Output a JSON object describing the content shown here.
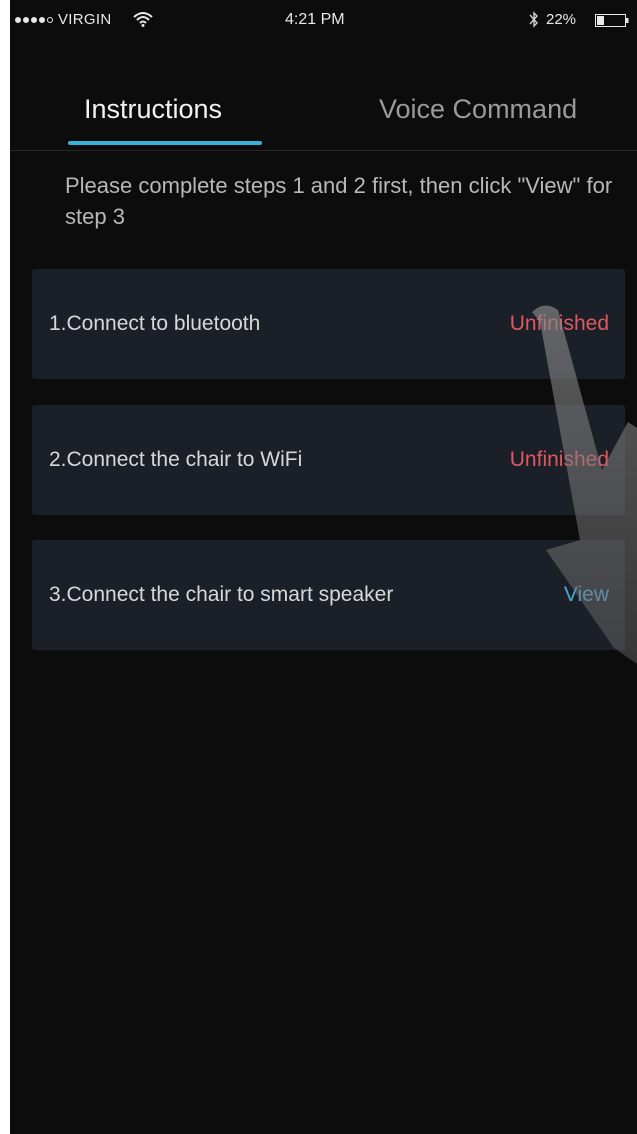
{
  "status_bar": {
    "carrier": "VIRGIN",
    "time": "4:21 PM",
    "battery": "22%"
  },
  "tabs": [
    {
      "label": "Instructions",
      "active": true
    },
    {
      "label": "Voice Command",
      "active": false
    }
  ],
  "info": "Please complete steps 1 and 2 first, then click \"View\" for step 3",
  "steps": [
    {
      "label": "1.Connect to bluetooth",
      "status": "Unfinished"
    },
    {
      "label": "2.Connect the chair to WiFi",
      "status": "Unfinished"
    },
    {
      "label": "3.Connect the chair to smart speaker",
      "status": "View"
    }
  ],
  "colors": {
    "background": "#0c0c0c",
    "card": "#1b1f27",
    "accent": "#39b0d8",
    "unfinished": "#e0585f",
    "view": "#4aa8d6"
  }
}
